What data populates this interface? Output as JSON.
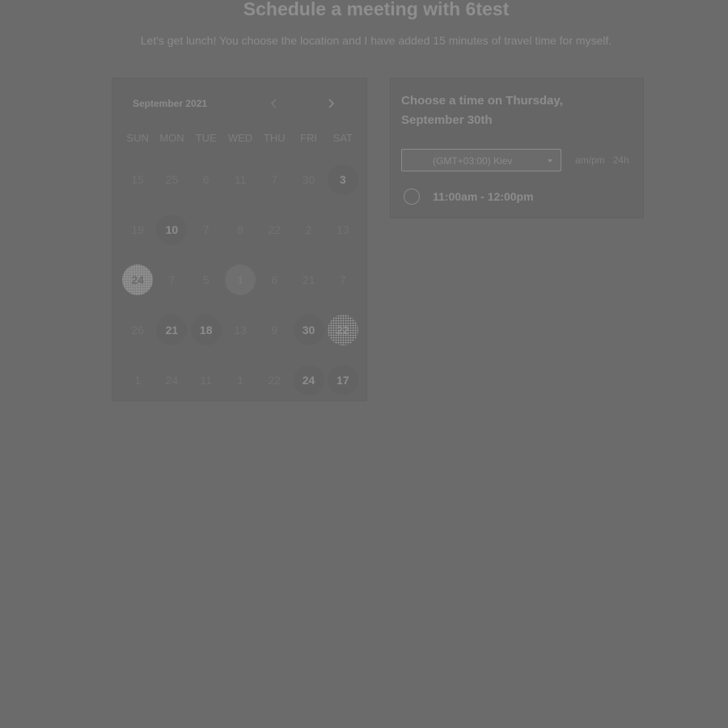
{
  "header": {
    "title": "Schedule a meeting with 6test",
    "subtitle": "Let's get lunch! You choose the location and I have added 15 minutes of travel time for myself."
  },
  "calendar": {
    "month_label": "September 2021",
    "prev_icon": "chevron-left-icon",
    "next_icon": "chevron-right-icon",
    "weekdays": [
      "SUN",
      "MON",
      "TUE",
      "WED",
      "THU",
      "FRI",
      "SAT"
    ],
    "weeks": [
      [
        {
          "d": "15",
          "s": "plain"
        },
        {
          "d": "25",
          "s": "plain"
        },
        {
          "d": "6",
          "s": "plain"
        },
        {
          "d": "11",
          "s": "plain"
        },
        {
          "d": "7",
          "s": "plain"
        },
        {
          "d": "30",
          "s": "plain"
        },
        {
          "d": "3",
          "s": "available"
        }
      ],
      [
        {
          "d": "19",
          "s": "plain"
        },
        {
          "d": "10",
          "s": "available"
        },
        {
          "d": "7",
          "s": "plain"
        },
        {
          "d": "8",
          "s": "plain"
        },
        {
          "d": "22",
          "s": "plain"
        },
        {
          "d": "2",
          "s": "plain"
        },
        {
          "d": "13",
          "s": "plain"
        }
      ],
      [
        {
          "d": "24",
          "s": "selected"
        },
        {
          "d": "7",
          "s": "plain"
        },
        {
          "d": "5",
          "s": "plain"
        },
        {
          "d": "1",
          "s": "today"
        },
        {
          "d": "6",
          "s": "plain"
        },
        {
          "d": "21",
          "s": "plain"
        },
        {
          "d": "7",
          "s": "plain"
        }
      ],
      [
        {
          "d": "26",
          "s": "plain"
        },
        {
          "d": "21",
          "s": "available"
        },
        {
          "d": "18",
          "s": "available"
        },
        {
          "d": "13",
          "s": "plain"
        },
        {
          "d": "9",
          "s": "plain"
        },
        {
          "d": "30",
          "s": "available"
        },
        {
          "d": "22",
          "s": "noisy"
        }
      ],
      [
        {
          "d": "1",
          "s": "plain"
        },
        {
          "d": "24",
          "s": "plain"
        },
        {
          "d": "11",
          "s": "plain"
        },
        {
          "d": "1",
          "s": "plain"
        },
        {
          "d": "22",
          "s": "plain"
        },
        {
          "d": "24",
          "s": "available"
        },
        {
          "d": "17",
          "s": "available"
        }
      ]
    ]
  },
  "times": {
    "heading": "Choose a time on Thursday, September 30th",
    "timezone": "(GMT+03:00) Kiev",
    "format_ampm": "am/pm",
    "format_24h": "24h",
    "slots": [
      {
        "label": "11:00am - 12:00pm"
      }
    ]
  }
}
